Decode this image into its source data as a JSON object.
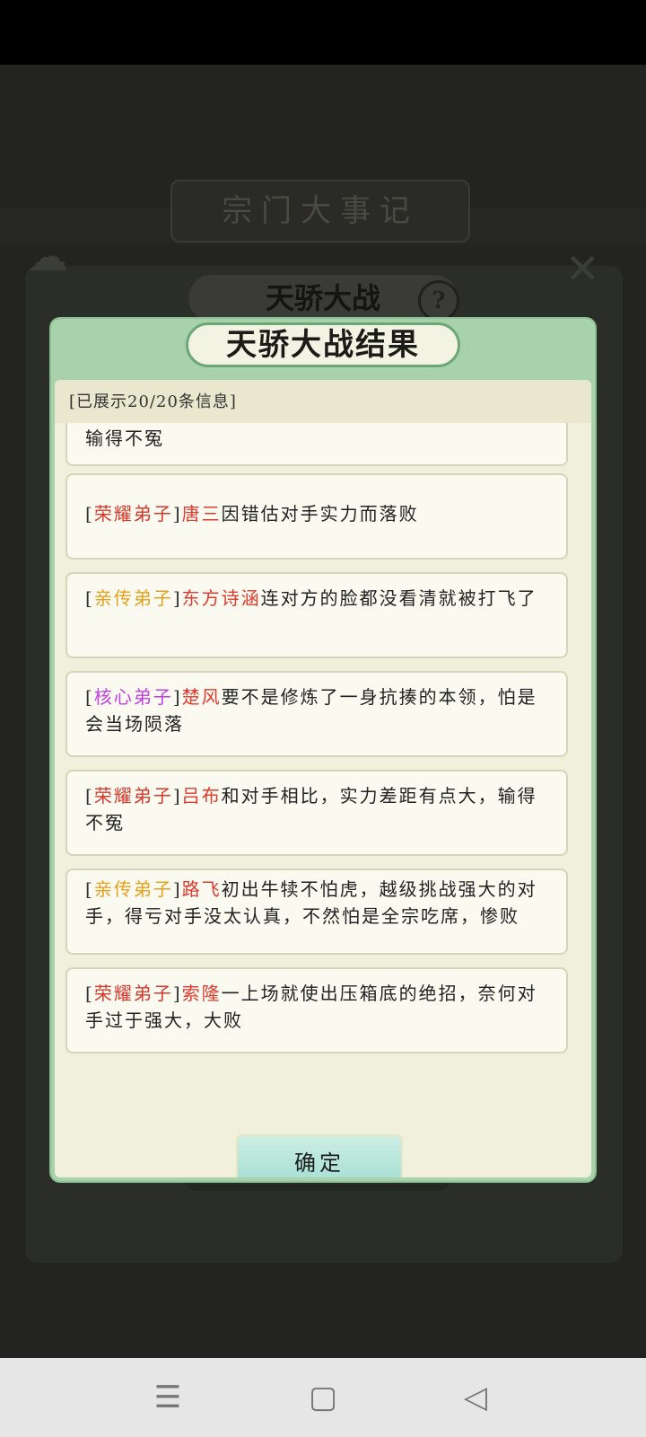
{
  "background": {
    "banner": "宗门大事记",
    "panel_title": "天骄大战",
    "help_icon": "?"
  },
  "modal": {
    "title": "天骄大战结果",
    "counter": "[已展示20/20条信息]",
    "confirm_label": "确定",
    "items": [
      {
        "text": "输得不冤"
      },
      {
        "rank_open": "[",
        "rank": "荣耀弟子",
        "rank_close": "]",
        "name": "唐三",
        "text": "因错估对手实力而落败"
      },
      {
        "rank_open": "[",
        "rank": "亲传弟子",
        "rank_close": "]",
        "name": "东方诗涵",
        "text": "连对方的脸都没看清就被打飞了"
      },
      {
        "rank_open": "[",
        "rank": "核心弟子",
        "rank_close": "]",
        "name": "楚风",
        "text": "要不是修炼了一身抗揍的本领，怕是会当场陨落"
      },
      {
        "rank_open": "[",
        "rank": "荣耀弟子",
        "rank_close": "]",
        "name": "吕布",
        "text": "和对手相比，实力差距有点大，输得不冤"
      },
      {
        "rank_open": "[",
        "rank": "亲传弟子",
        "rank_close": "]",
        "name": "路飞",
        "text": "初出牛犊不怕虎，越级挑战强大的对手，得亏对手没太认真，不然怕是全宗吃席，惨败"
      },
      {
        "rank_open": "[",
        "rank": "荣耀弟子",
        "rank_close": "]",
        "name": "索隆",
        "text": "一上场就使出压箱底的绝招，奈何对手过于强大，大败"
      }
    ]
  },
  "navbar": {
    "menu_icon": "☰",
    "home_icon": "▢",
    "back_icon": "◁"
  },
  "colors": {
    "glory": "#d8382c",
    "direct": "#e7a01c",
    "core": "#c33fe6",
    "name": "#e03a2f",
    "modal_green": "#a7d2ab",
    "confirm_teal": "#9fdcd0"
  }
}
